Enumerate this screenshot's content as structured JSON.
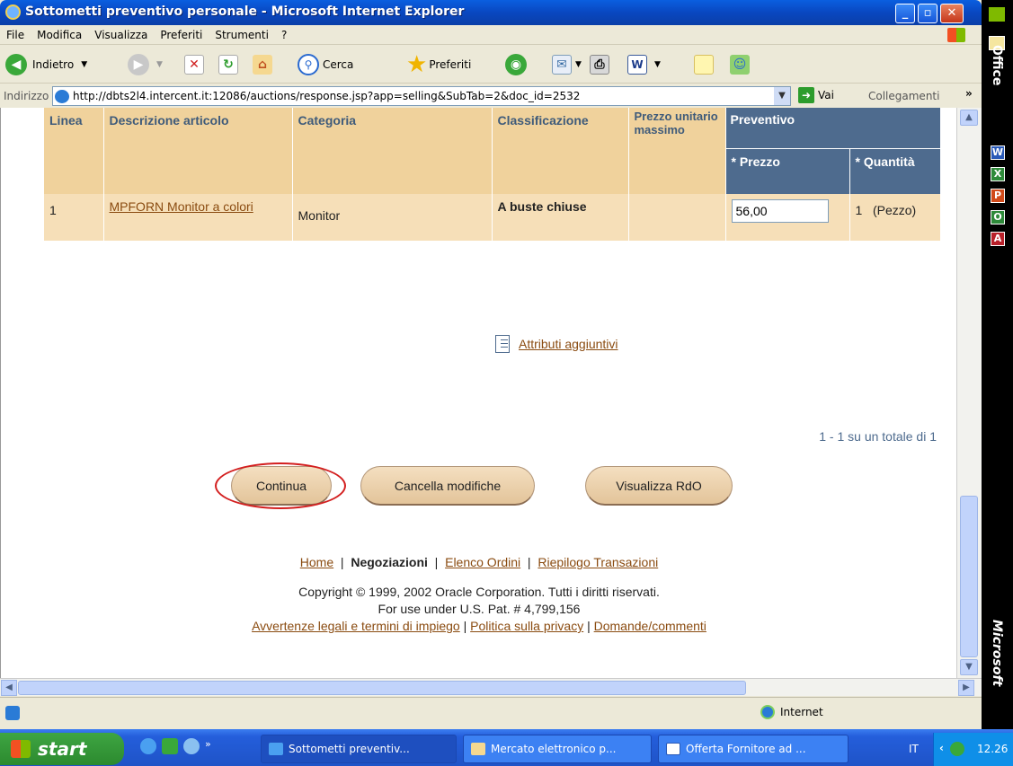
{
  "window": {
    "title": "Sottometti preventivo personale - Microsoft Internet Explorer"
  },
  "menu": [
    "File",
    "Modifica",
    "Visualizza",
    "Preferiti",
    "Strumenti",
    "?"
  ],
  "toolbar": {
    "back": "Indietro",
    "search": "Cerca",
    "favorites": "Preferiti"
  },
  "address": {
    "label": "Indirizzo",
    "url": "http://dbts2l4.intercent.it:12086/auctions/response.jsp?app=selling&SubTab=2&doc_id=2532",
    "go": "Vai",
    "links": "Collegamenti"
  },
  "table": {
    "headers": {
      "line": "Linea",
      "desc": "Descrizione articolo",
      "category": "Categoria",
      "class": "Classificazione",
      "maxprice": "Prezzo unitario massimo",
      "quote": "Preventivo",
      "price": "* Prezzo",
      "qty": "* Quantità"
    },
    "rows": [
      {
        "line": "1",
        "desc": "MPFORN Monitor a colori",
        "category": "Monitor",
        "class": "A buste chiuse",
        "maxprice": "",
        "price": "56,00",
        "qty": "1",
        "unit": "(Pezzo)"
      }
    ]
  },
  "extra": {
    "attributes_link": "Attributi aggiuntivi",
    "count": "1 - 1 su un totale di 1"
  },
  "buttons": {
    "continue": "Continua",
    "cancel": "Cancella modifiche",
    "view": "Visualizza RdO"
  },
  "footer": {
    "home": "Home",
    "negotiations": "Negoziazioni",
    "orders": "Elenco Ordini",
    "summary": "Riepilogo Transazioni",
    "copyright": "Copyright © 1999, 2002 Oracle Corporation. Tutti i diritti riservati.",
    "patent": "For use under U.S. Pat. # 4,799,156",
    "legal": "Avvertenze legali e termini di impiego",
    "privacy": "Politica sulla privacy",
    "comments": "Domande/commenti"
  },
  "status": {
    "zone": "Internet"
  },
  "officebar": {
    "top": "Office",
    "bottom": "Microsoft"
  },
  "taskbar": {
    "start": "start",
    "tasks": [
      "Sottometti preventiv...",
      "Mercato elettronico p...",
      "Offerta Fornitore ad ..."
    ],
    "lang": "IT",
    "clock": "12.26"
  }
}
